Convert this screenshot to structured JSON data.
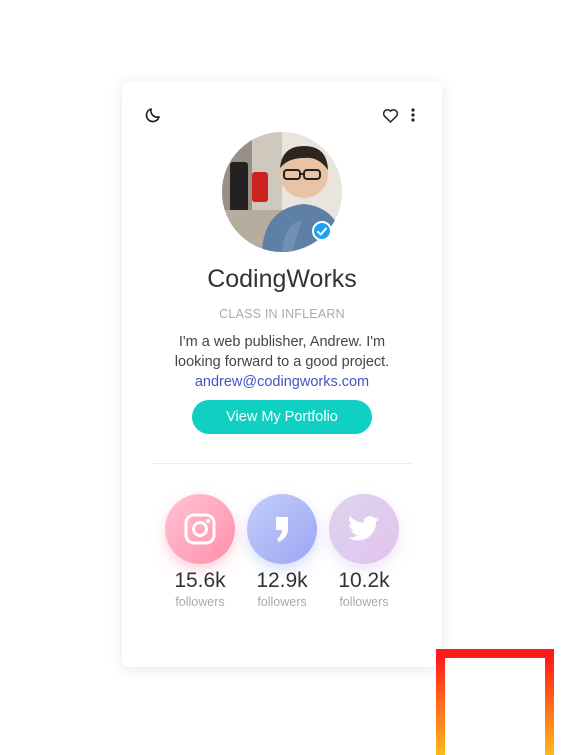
{
  "profile": {
    "name": "CodingWorks",
    "subtitle": "CLASS IN INFLEARN",
    "bio_line1": "I'm a web publisher, Andrew. I'm",
    "bio_line2": "looking forward to a good project.",
    "email": "andrew@codingworks.com",
    "portfolio_button": "View My Portfolio"
  },
  "social": [
    {
      "platform": "instagram",
      "icon": "instagram-icon",
      "count": "15.6k",
      "label": "followers"
    },
    {
      "platform": "brunch",
      "icon": "brunch-icon",
      "count": "12.9k",
      "label": "followers"
    },
    {
      "platform": "twitter",
      "icon": "twitter-icon",
      "count": "10.2k",
      "label": "followers"
    }
  ],
  "icons": {
    "theme_toggle": "moon-icon",
    "like": "heart-icon",
    "menu": "more-vertical-icon",
    "verified": "verified-check-icon"
  },
  "colors": {
    "accent": "#0fd0c3",
    "link": "#3f55c5",
    "verified": "#1ea1f1",
    "frame_top": "#ff1a1a",
    "frame_bottom": "#ffc21a"
  }
}
